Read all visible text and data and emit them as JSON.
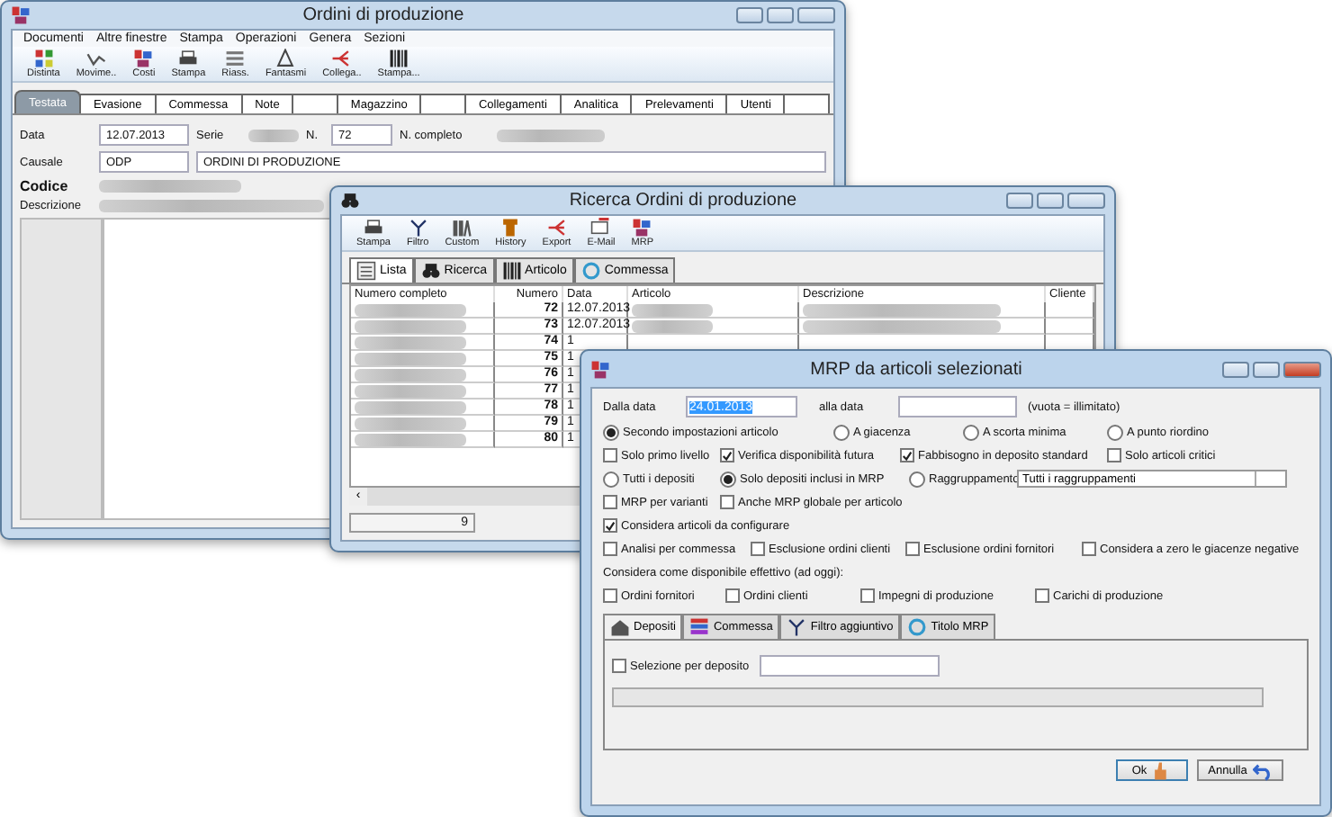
{
  "production_window": {
    "title": "Ordini di produzione",
    "menu": [
      "Documenti",
      "Altre finestre",
      "Stampa",
      "Operazioni",
      "Genera",
      "Sezioni"
    ],
    "toolbar": [
      "Distinta",
      "Movime..",
      "Costi",
      "Stampa",
      "Riass.",
      "Fantasmi",
      "Collega..",
      "Stampa..."
    ],
    "tabs": [
      {
        "label": "Testata",
        "selected": true
      },
      {
        "label": "Evasione",
        "selected": false
      },
      {
        "label": "Commessa",
        "selected": false
      },
      {
        "label": "Note",
        "selected": false
      },
      {
        "selected": false
      },
      {
        "label": "Magazzino",
        "selected": false
      },
      {
        "selected": false
      },
      {
        "label": "Collegamenti",
        "selected": false
      },
      {
        "label": "Analitica",
        "selected": false
      },
      {
        "label": "Prelevamenti",
        "selected": false
      },
      {
        "label": "Utenti",
        "selected": false
      },
      {
        "selected": false
      }
    ],
    "data_label": "Data",
    "data_value": "12.07.2013",
    "serie_label": "Serie",
    "n_label": "N.",
    "n_value": "72",
    "n_completo_label": "N. completo",
    "causale_label": "Causale",
    "causale_value": "ODP",
    "causale_description": "ORDINI DI PRODUZIONE",
    "codice_label": "Codice",
    "descrizione_label": "Descrizione"
  },
  "search_window": {
    "title": "Ricerca Ordini di produzione",
    "toolbar": [
      "Stampa",
      "Filtro",
      "Custom",
      "History",
      "Export",
      "E-Mail",
      "MRP"
    ],
    "tabs": [
      {
        "label": "Lista",
        "selected": true
      },
      {
        "label": "Ricerca",
        "selected": false
      },
      {
        "label": "Articolo",
        "selected": false
      },
      {
        "label": "Commessa",
        "selected": false
      }
    ],
    "columns": [
      "Numero completo",
      "Numero",
      "Data",
      "Articolo",
      "Descrizione",
      "Cliente"
    ],
    "rows": [
      {
        "numero": "72",
        "data": "12.07.2013"
      },
      {
        "numero": "73",
        "data": "12.07.2013"
      },
      {
        "numero": "74",
        "data": "1"
      },
      {
        "numero": "75",
        "data": "1"
      },
      {
        "numero": "76",
        "data": "1"
      },
      {
        "numero": "77",
        "data": "1"
      },
      {
        "numero": "78",
        "data": "1"
      },
      {
        "numero": "79",
        "data": "1"
      },
      {
        "numero": "80",
        "data": "1"
      }
    ],
    "scroll_left": "‹",
    "count": "9"
  },
  "mrp_dialog": {
    "title": "MRP da articoli selezionati",
    "from_label": "Dalla data",
    "from_value": "24.01.2013",
    "to_label": "alla data",
    "to_hint": "(vuota = illimitato)",
    "rows": [
      [
        {
          "kind": "radio",
          "label": "Secondo impostazioni articolo",
          "selected": true
        },
        {
          "kind": "radio",
          "label": "A giacenza",
          "selected": false
        },
        {
          "kind": "radio",
          "label": "A scorta minima",
          "selected": false
        },
        {
          "kind": "radio",
          "label": "A punto riordino",
          "selected": false
        }
      ],
      [
        {
          "kind": "checkbox",
          "label": "Solo primo livello",
          "checked": false
        },
        {
          "kind": "checkbox",
          "label": "Verifica disponibilità futura",
          "checked": true
        },
        {
          "kind": "checkbox",
          "label": "Fabbisogno in deposito standard",
          "checked": true
        },
        {
          "kind": "checkbox",
          "label": "Solo articoli critici",
          "checked": false
        }
      ],
      [
        {
          "kind": "radio",
          "label": "Tutti i depositi",
          "selected": false
        },
        {
          "kind": "radio",
          "label": "Solo depositi inclusi in MRP",
          "selected": true
        },
        {
          "kind": "radio",
          "label": "Raggruppamento",
          "selected": false
        },
        {
          "kind": "dropdown",
          "label": "Tutti i raggruppamenti"
        }
      ],
      [
        {
          "kind": "checkbox",
          "label": "MRP per varianti",
          "checked": false
        },
        {
          "kind": "checkbox",
          "label": "Anche MRP globale per articolo",
          "checked": false
        }
      ],
      [
        {
          "kind": "checkbox",
          "label": "Considera articoli da configurare",
          "checked": true
        }
      ],
      [
        {
          "kind": "checkbox",
          "label": "Analisi per commessa",
          "checked": false
        },
        {
          "kind": "checkbox",
          "label": "Esclusione ordini clienti",
          "checked": false
        },
        {
          "kind": "checkbox",
          "label": "Esclusione ordini fornitori",
          "checked": false
        },
        {
          "kind": "checkbox",
          "label": "Considera a zero le giacenze negative",
          "checked": false
        }
      ],
      [
        {
          "kind": "text",
          "label": "Considera come disponibile effettivo (ad oggi):"
        }
      ],
      [
        {
          "kind": "checkbox",
          "label": "Ordini fornitori",
          "checked": false
        },
        {
          "kind": "checkbox",
          "label": "Ordini clienti",
          "checked": false
        },
        {
          "kind": "checkbox",
          "label": "Impegni di produzione",
          "checked": false
        },
        {
          "kind": "checkbox",
          "label": "Carichi di produzione",
          "checked": false
        }
      ]
    ],
    "tabs": [
      {
        "label": "Depositi",
        "selected": true
      },
      {
        "label": "Commessa",
        "selected": false
      },
      {
        "label": "Filtro aggiuntivo",
        "selected": false
      },
      {
        "label": "Titolo MRP",
        "selected": false
      }
    ],
    "selection": {
      "label": "Selezione per deposito",
      "checked": false
    },
    "buttons": [
      "Ok",
      "Annulla"
    ]
  }
}
